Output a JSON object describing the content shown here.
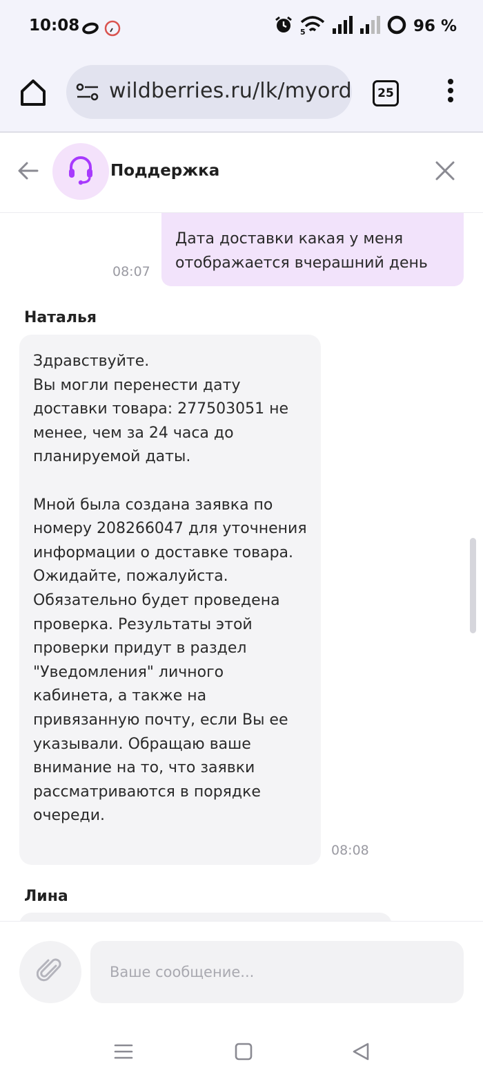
{
  "status_bar": {
    "time": "10:08",
    "battery": "96 %"
  },
  "browser": {
    "url": "wildberries.ru/lk/myorders",
    "tabs_count": "25"
  },
  "chat_header": {
    "title": "Поддержка"
  },
  "messages": {
    "outgoing": {
      "text": "Дата доставки какая у меня отображается вчерашний день",
      "time": "08:07"
    },
    "incoming": {
      "sender": "Наталья",
      "text": "Здравствуйте.\nВы могли перенести дату доставки товара: 277503051 не менее, чем за 24 часа до планируемой даты.\n\nМной была создана заявка по номеру 208266047 для уточнения информации о доставке товара.\nОжидайте, пожалуйста. Обязательно будет проведена проверка. Результаты этой проверки придут в раздел \"Уведомления\" личного кабинета, а также на привязанную почту, если Вы ее указывали. Обращаю ваше внимание на то, что заявки рассматриваются в порядке очереди.",
      "time": "08:08"
    },
    "next_sender": "Лина"
  },
  "composer": {
    "placeholder": "Ваше сообщение..."
  },
  "colors": {
    "accent": "#a73afd",
    "outgoing_bubble": "#f2e3fb",
    "incoming_bubble": "#f4f4f6"
  }
}
